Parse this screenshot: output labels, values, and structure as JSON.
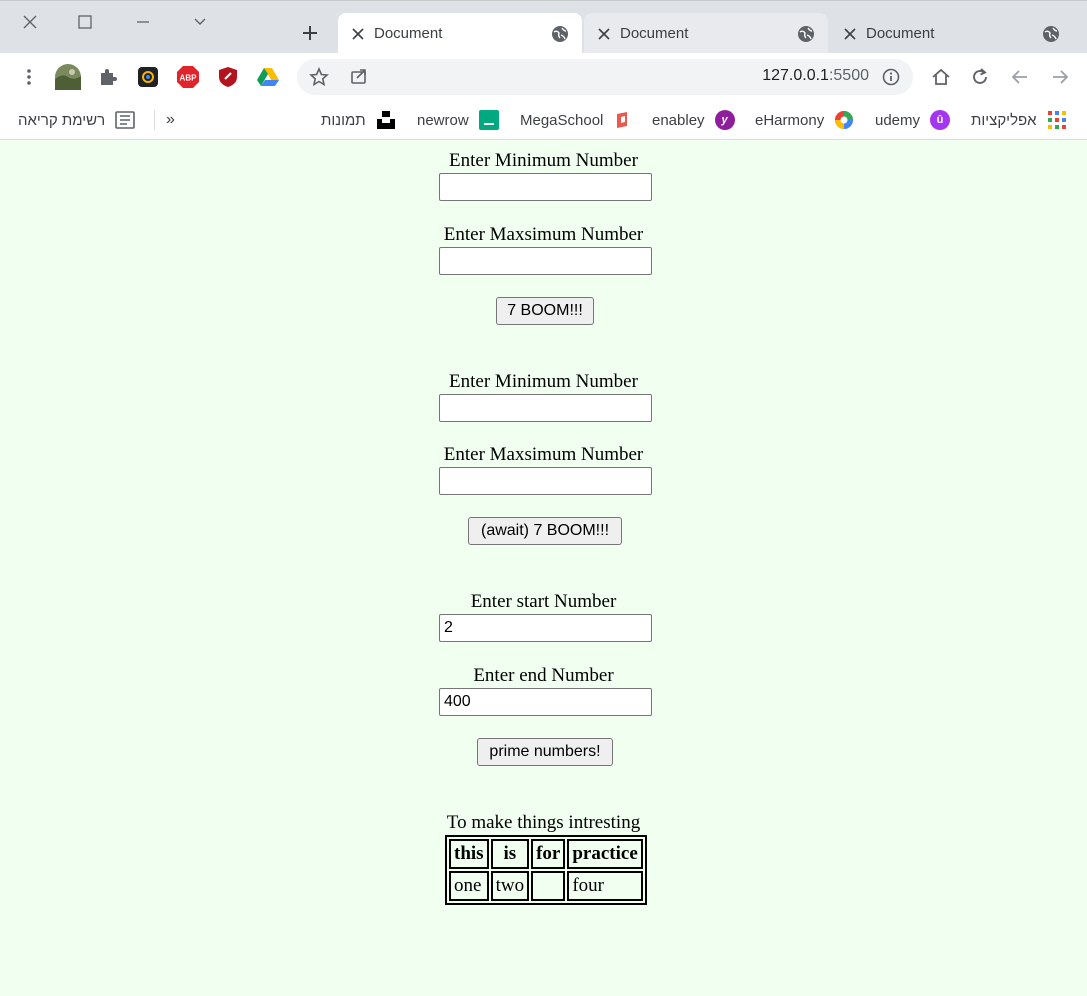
{
  "tabs": [
    {
      "title": "Document",
      "active": true
    },
    {
      "title": "Document",
      "active": false
    },
    {
      "title": "Document",
      "active": false
    }
  ],
  "toolbar": {
    "url_host": "127.0.0.1",
    "url_port": ":5500",
    "extensions": [
      "menu-dots-icon",
      "profile-avatar",
      "extensions-puzzle-icon",
      "camera-extension-icon",
      "adblock-icon",
      "red-shield-icon",
      "google-drive-icon"
    ]
  },
  "bookmarks": {
    "reading_list": "רשימת קריאה",
    "overflow": "»",
    "items": [
      {
        "label": "תמונות",
        "icon": "unsplash-icon"
      },
      {
        "label": "newrow",
        "icon": "newrow-icon"
      },
      {
        "label": "MegaSchool",
        "icon": "megaschool-icon"
      },
      {
        "label": "enabley",
        "icon": "enabley-icon"
      },
      {
        "label": "eHarmony",
        "icon": "eharmony-icon"
      },
      {
        "label": "udemy",
        "icon": "udemy-icon"
      },
      {
        "label": "אפליקציות",
        "icon": "apps-grid-icon"
      }
    ]
  },
  "form1": {
    "min_label": "Enter Minimum Number",
    "min_value": "",
    "max_label": "Enter Maxsimum Number",
    "max_value": "",
    "button": "7 BOOM!!!"
  },
  "form2": {
    "min_label": "Enter Minimum Number",
    "min_value": "",
    "max_label": "Enter Maxsimum Number",
    "max_value": "",
    "button": "(await) 7 BOOM!!!"
  },
  "form3": {
    "start_label": "Enter start Number",
    "start_value": "2",
    "end_label": "Enter end Number",
    "end_value": "400",
    "button": "prime numbers!"
  },
  "table_section": {
    "caption": "To make things intresting",
    "headers": [
      "this",
      "is",
      "for",
      "practice"
    ],
    "row": [
      "one",
      "two",
      "",
      "four"
    ]
  }
}
